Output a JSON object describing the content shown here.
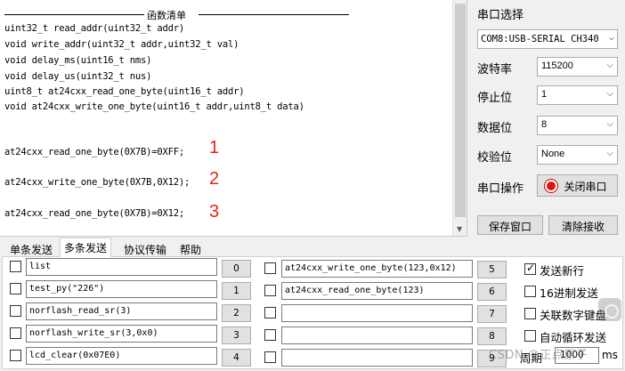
{
  "terminal": {
    "header": "函数清单",
    "lines": [
      "uint32_t read_addr(uint32_t addr)",
      "void write_addr(uint32_t addr,uint32_t val)",
      "void delay_ms(uint16_t nms)",
      "void delay_us(uint32_t nus)",
      "uint8_t at24cxx_read_one_byte(uint16_t addr)",
      "void at24cxx_write_one_byte(uint16_t addr,uint8_t data)",
      "at24cxx_read_one_byte(0X7B)=0XFF;",
      "at24cxx_write_one_byte(0X7B,0X12);",
      "at24cxx_read_one_byte(0X7B)=0X12;"
    ],
    "annotations": [
      "1",
      "2",
      "3"
    ]
  },
  "panel": {
    "port_label": "串口选择",
    "port_value": "COM8:USB-SERIAL CH340",
    "baud_label": "波特率",
    "baud_value": "115200",
    "stop_label": "停止位",
    "stop_value": "1",
    "data_label": "数据位",
    "data_value": "8",
    "parity_label": "校验位",
    "parity_value": "None",
    "op_label": "串口操作",
    "toggle_button": "关闭串口",
    "save_button": "保存窗口",
    "clear_button": "清除接收",
    "led_color": "#e3140d"
  },
  "tabs": [
    "单条发送",
    "多条发送",
    "协议传输",
    "帮助"
  ],
  "active_tab": "多条发送",
  "multi_send": {
    "left": [
      {
        "text": "list",
        "num": "0"
      },
      {
        "text": "test_py(\"226\")",
        "num": "1"
      },
      {
        "text": "norflash_read_sr(3)",
        "num": "2"
      },
      {
        "text": "norflash_write_sr(3,0x0)",
        "num": "3"
      },
      {
        "text": "lcd_clear(0x07E0)",
        "num": "4"
      }
    ],
    "right": [
      {
        "text": "at24cxx_write_one_byte(123,0x12)",
        "num": "5"
      },
      {
        "text": "at24cxx_read_one_byte(123)",
        "num": "6"
      },
      {
        "text": "",
        "num": "7"
      },
      {
        "text": "",
        "num": "8"
      },
      {
        "text": "",
        "num": "9"
      }
    ]
  },
  "options": {
    "newline": {
      "label": "发送新行",
      "checked": true
    },
    "hex": {
      "label": "16进制发送",
      "checked": false
    },
    "keyboard": {
      "label": "关联数字键盘",
      "checked": false
    },
    "loop": {
      "label": "自动循环发送",
      "checked": false
    },
    "period_label": "周期",
    "period_value": "1000",
    "period_unit": "ms"
  },
  "watermark": "CSDN @正点原子"
}
